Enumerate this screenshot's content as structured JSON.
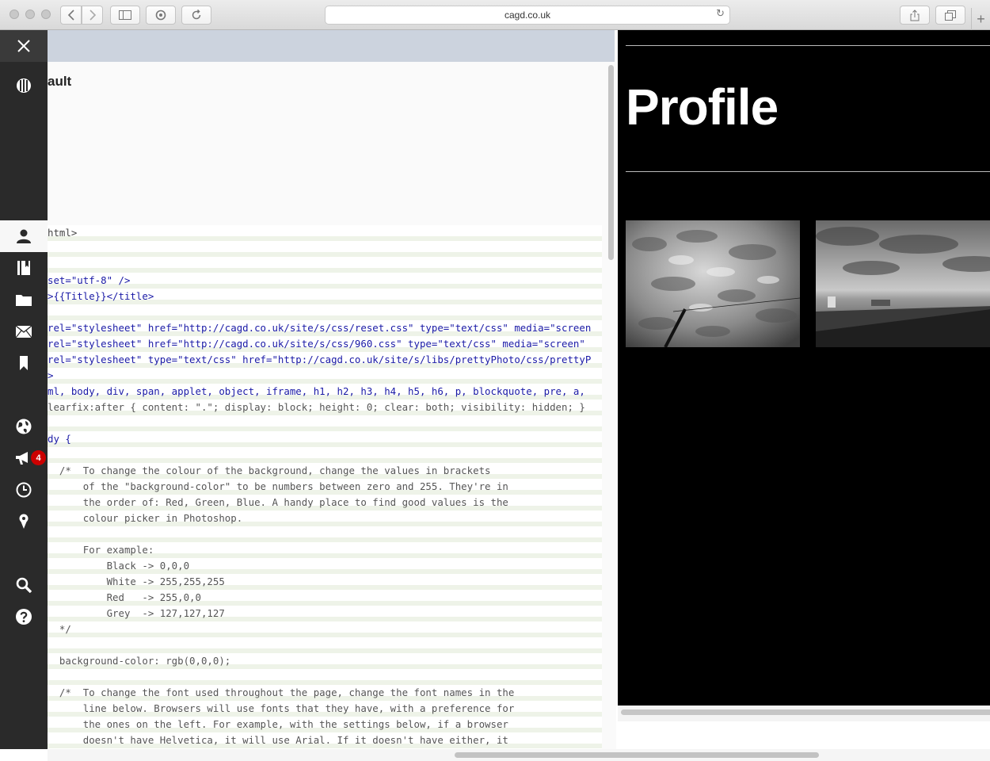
{
  "browser": {
    "url": "cagd.co.uk",
    "buttons": {
      "back": "back-icon",
      "forward": "forward-icon",
      "sidebar": "sidebar-icon",
      "extension": "extension-icon",
      "refresh": "refresh-icon",
      "share": "share-icon",
      "tabs": "tabs-icon",
      "new_tab": "+"
    }
  },
  "sidebar": {
    "items": [
      {
        "icon": "close-icon"
      },
      {
        "icon": "theme-icon"
      },
      {
        "icon": "user-icon"
      },
      {
        "icon": "book-icon"
      },
      {
        "icon": "folder-icon"
      },
      {
        "icon": "mail-icon"
      },
      {
        "icon": "bookmark-icon"
      },
      {
        "icon": "globe-icon"
      },
      {
        "icon": "megaphone-icon",
        "badge": "4"
      },
      {
        "icon": "clock-icon"
      },
      {
        "icon": "location-icon"
      },
      {
        "icon": "search-icon"
      },
      {
        "icon": "help-icon"
      }
    ]
  },
  "editor": {
    "template_name": "ault",
    "code_lines": [
      "html>",
      "",
      "",
      "set=\"utf-8\" />",
      ">{{Title}}</title>",
      "",
      "rel=\"stylesheet\" href=\"http://cagd.co.uk/site/s/css/reset.css\" type=\"text/css\" media=\"screen",
      "rel=\"stylesheet\" href=\"http://cagd.co.uk/site/s/css/960.css\" type=\"text/css\" media=\"screen\"",
      "rel=\"stylesheet\" type=\"text/css\" href=\"http://cagd.co.uk/site/s/libs/prettyPhoto/css/prettyP",
      ">",
      "ml, body, div, span, applet, object, iframe, h1, h2, h3, h4, h5, h6, p, blockquote, pre, a,",
      "learfix:after { content: \".\"; display: block; height: 0; clear: both; visibility: hidden; }",
      "",
      "dy {",
      "",
      "  /*  To change the colour of the background, change the values in brackets",
      "      of the \"background-color\" to be numbers between zero and 255. They're in",
      "      the order of: Red, Green, Blue. A handy place to find good values is the",
      "      colour picker in Photoshop.",
      "",
      "      For example:",
      "          Black -> 0,0,0",
      "          White -> 255,255,255",
      "          Red   -> 255,0,0",
      "          Grey  -> 127,127,127",
      "  */",
      "",
      "  background-color: rgb(0,0,0);",
      "",
      "  /*  To change the font used throughout the page, change the font names in the",
      "      line below. Browsers will use fonts that they have, with a preference for",
      "      the ones on the left. For example, with the settings below, if a browser",
      "      doesn't have Helvetica, it will use Arial. If it doesn't have either, it"
    ]
  },
  "preview": {
    "title": "Profile",
    "background": "#000000",
    "photos": [
      "cloudy-sky-photo",
      "beach-photo"
    ]
  }
}
